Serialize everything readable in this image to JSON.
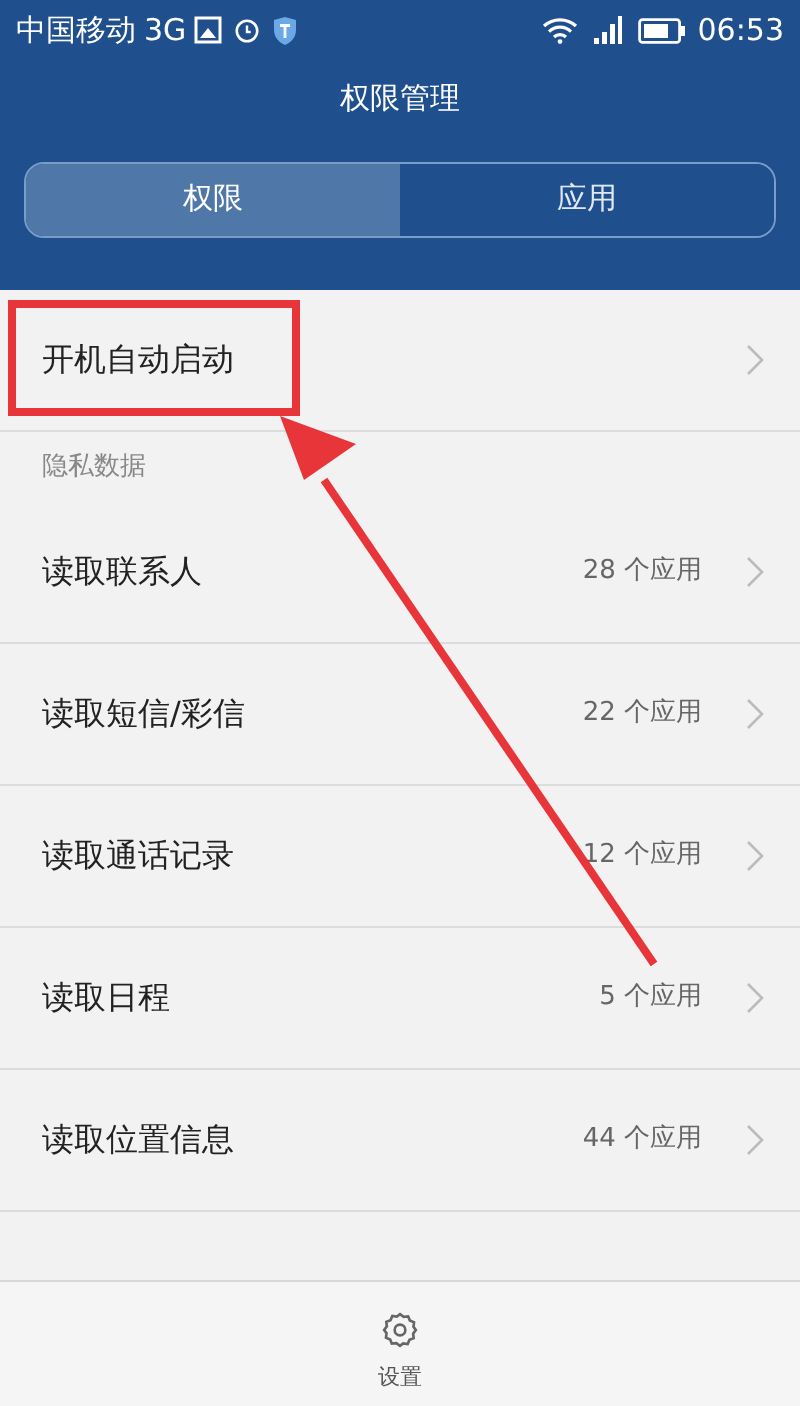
{
  "status_bar": {
    "carrier": "中国移动",
    "network": "3G",
    "time": "06:53"
  },
  "title": "权限管理",
  "tabs": [
    {
      "label": "权限",
      "selected": true
    },
    {
      "label": "应用",
      "selected": false
    }
  ],
  "items": [
    {
      "kind": "row",
      "label": "开机自动启动"
    },
    {
      "kind": "section",
      "label": "隐私数据"
    },
    {
      "kind": "row",
      "label": "读取联系人",
      "count": "28 个应用"
    },
    {
      "kind": "row",
      "label": "读取短信/彩信",
      "count": "22 个应用"
    },
    {
      "kind": "row",
      "label": "读取通话记录",
      "count": "12 个应用"
    },
    {
      "kind": "row",
      "label": "读取日程",
      "count": "5 个应用"
    },
    {
      "kind": "row",
      "label": "读取位置信息",
      "count": "44 个应用"
    }
  ],
  "bottom_bar": {
    "label": "设置"
  },
  "annotation": {
    "highlight_box": true,
    "arrow": true
  }
}
